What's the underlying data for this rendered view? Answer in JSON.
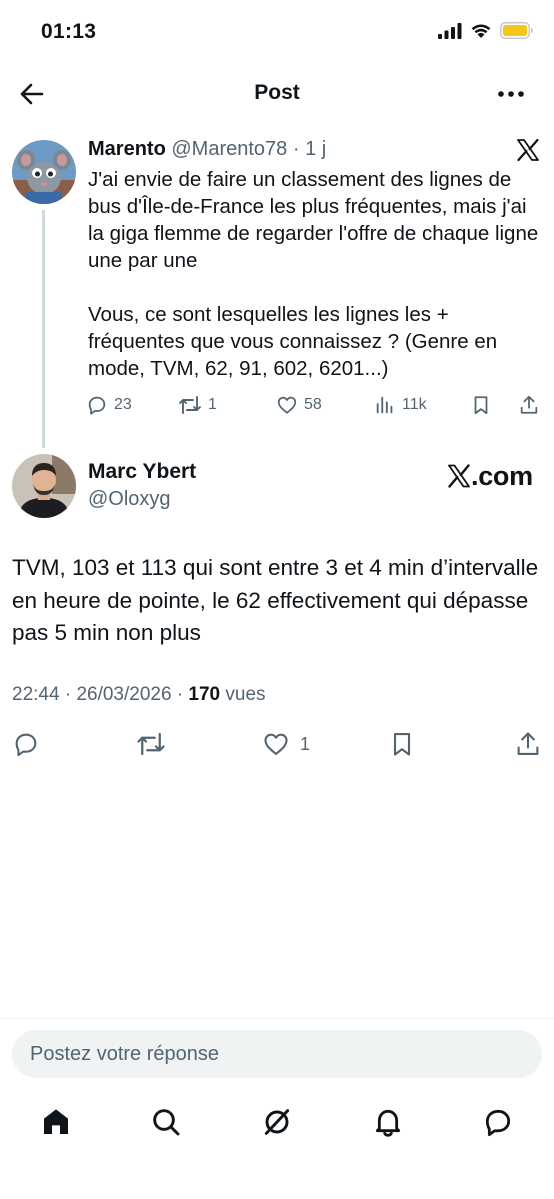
{
  "status_bar": {
    "time": "01:13",
    "signal_icon": "signal-bars-icon",
    "wifi_icon": "wifi-icon",
    "battery_icon": "battery-icon",
    "battery_color": "#f5c518"
  },
  "header": {
    "title": "Post",
    "back_icon": "arrow-left-icon",
    "more_icon": "more-horizontal-icon"
  },
  "parent_tweet": {
    "author_name": "Marento",
    "handle": "@Marento78",
    "separator": "·",
    "age": "1 j",
    "text": "J'ai envie de faire un classement des lignes de bus d'Île-de-France les plus fréquentes, mais j'ai la giga flemme de regarder l'offre de chaque ligne une par une\n\nVous, ce sont lesquelles les lignes les + fréquentes que vous connaissez ? (Genre en mode, TVM, 62, 91, 602, 6201...)",
    "replies": "23",
    "retweets": "1",
    "likes": "58",
    "views": "11k"
  },
  "reply_tweet": {
    "author_name": "Marc Ybert",
    "handle": "@Oloxyg",
    "badge_text": ".com",
    "text": "TVM, 103 et 113 qui sont entre 3 et 4 min d’intervalle en heure de pointe, le 62 effectivement qui dépasse pas 5 min non plus",
    "time": "22:44",
    "separator": "·",
    "date": "26/03/2026",
    "views_count": "170",
    "views_label": "vues",
    "likes": "1"
  },
  "reply_box": {
    "placeholder": "Postez votre réponse"
  },
  "bottom_nav": {
    "items": [
      "home-icon",
      "search-icon",
      "grok-icon",
      "notifications-icon",
      "messages-icon"
    ]
  },
  "colors": {
    "text_primary": "#0f1419",
    "text_secondary": "#536471",
    "divider": "#eff3f4",
    "thread_line": "#cfd9de"
  }
}
